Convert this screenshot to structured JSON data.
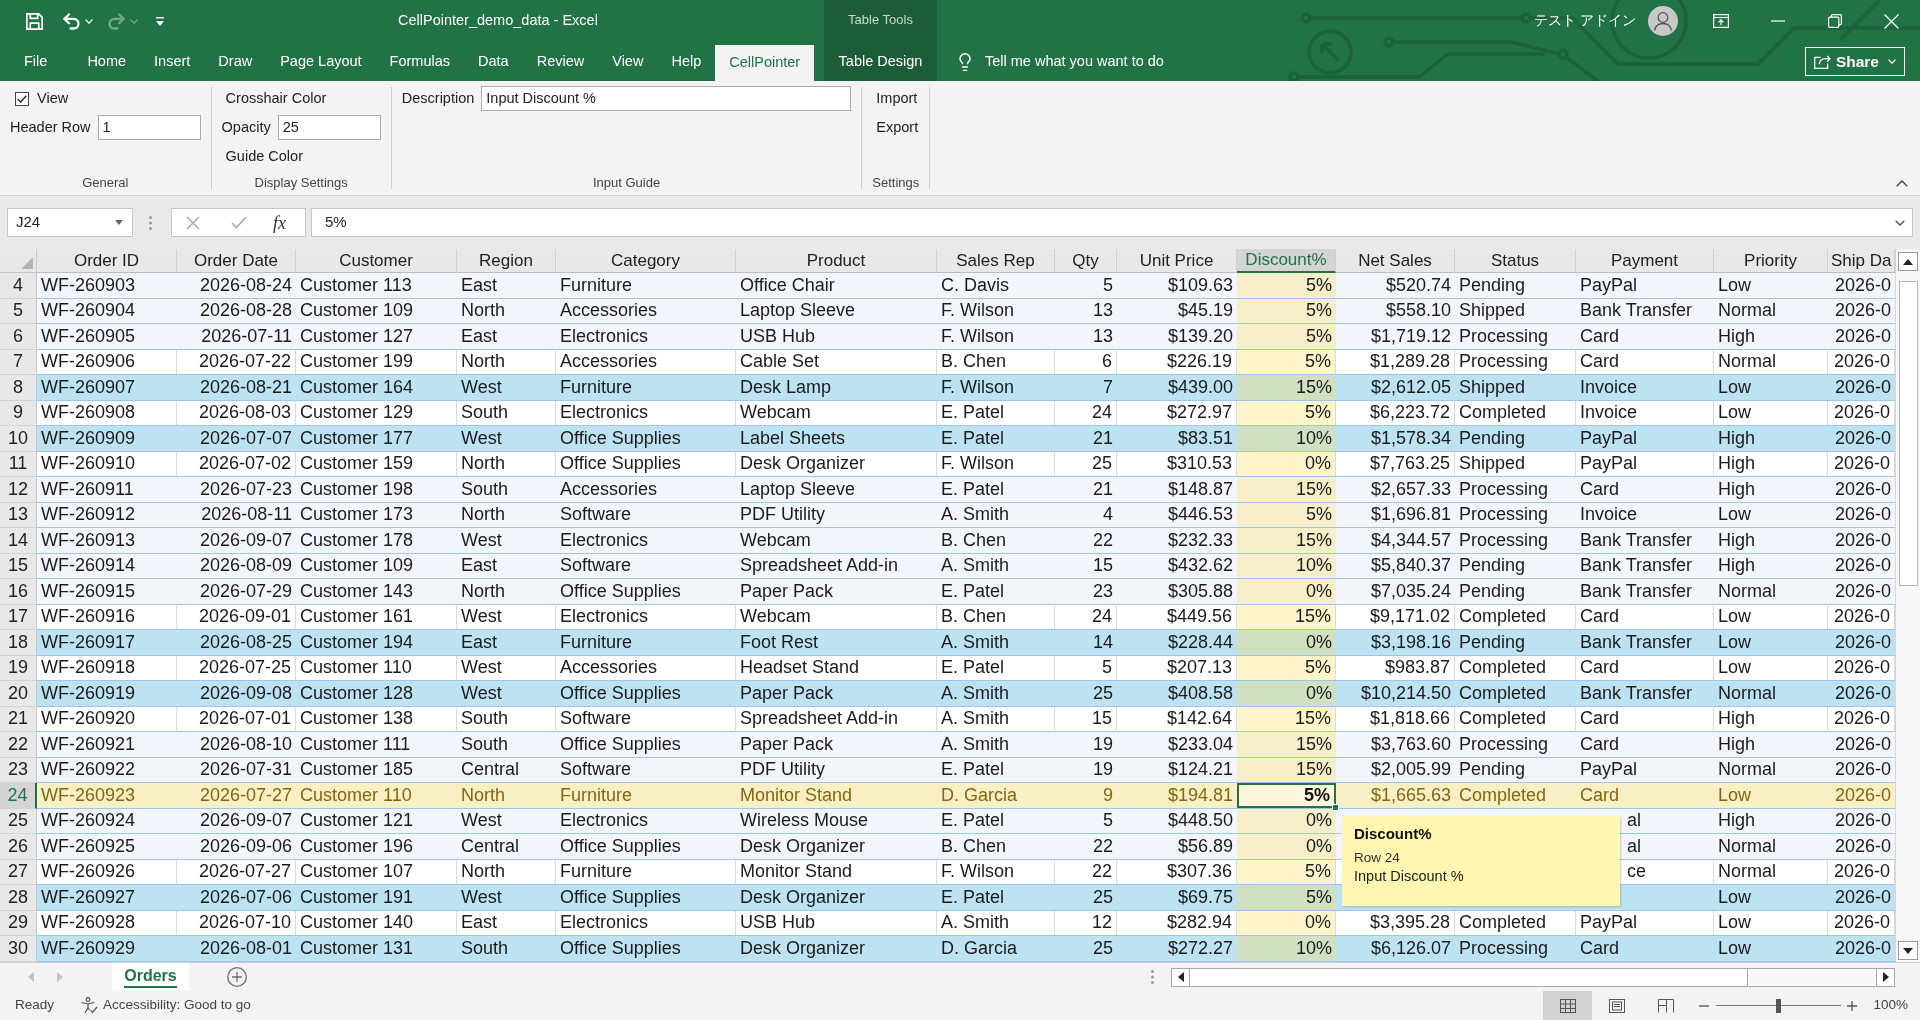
{
  "title_bar": {
    "quick_access": [
      {
        "kind": "save",
        "disabled": false
      },
      {
        "kind": "undo",
        "disabled": false
      },
      {
        "kind": "redo",
        "disabled": true
      },
      {
        "kind": "customize",
        "disabled": false
      }
    ],
    "document_title": "CellPointer_demo_data - Excel",
    "context_label": "Table Tools",
    "user_name": "テスト アドイン"
  },
  "ribbon_tabs": [
    {
      "label": "File",
      "kind": "file",
      "selected": false
    },
    {
      "label": "Home",
      "kind": "standard",
      "selected": false
    },
    {
      "label": "Insert",
      "kind": "standard",
      "selected": false
    },
    {
      "label": "Draw",
      "kind": "standard",
      "selected": false
    },
    {
      "label": "Page Layout",
      "kind": "standard",
      "selected": false
    },
    {
      "label": "Formulas",
      "kind": "standard",
      "selected": false
    },
    {
      "label": "Data",
      "kind": "standard",
      "selected": false
    },
    {
      "label": "Review",
      "kind": "standard",
      "selected": false
    },
    {
      "label": "View",
      "kind": "standard",
      "selected": false
    },
    {
      "label": "Help",
      "kind": "standard",
      "selected": false
    },
    {
      "label": "CellPointer",
      "kind": "standard",
      "selected": true
    },
    {
      "label": "Table Design",
      "kind": "contextual",
      "selected": false
    }
  ],
  "tell_me": {
    "placeholder": "Tell me what you want to do"
  },
  "share_button": {
    "label": "Share"
  },
  "ribbon": {
    "groups": [
      {
        "label": "General",
        "controls": [
          {
            "kind": "checkbox",
            "label": "View",
            "checked": true
          },
          {
            "kind": "field",
            "label": "Header Row",
            "value": "1"
          }
        ]
      },
      {
        "label": "Display Settings",
        "controls": [
          {
            "kind": "button",
            "label": "Crosshair Color"
          },
          {
            "kind": "field",
            "label": "Opacity",
            "value": "25"
          },
          {
            "kind": "button",
            "label": "Guide Color"
          }
        ]
      },
      {
        "label": "Input Guide",
        "controls": [
          {
            "kind": "wide_field",
            "label": "Description",
            "value": "Input Discount %"
          }
        ]
      },
      {
        "label": "Settings",
        "controls": [
          {
            "kind": "button",
            "label": "Import"
          },
          {
            "kind": "button",
            "label": "Export"
          }
        ]
      }
    ]
  },
  "formula_bar": {
    "name_box": "J24",
    "function_label": "fx",
    "formula": "5%"
  },
  "sheet": {
    "columns": [
      {
        "label": "Order ID",
        "kind": "text",
        "selected": false
      },
      {
        "label": "Order Date",
        "kind": "date",
        "selected": false
      },
      {
        "label": "Customer",
        "kind": "text",
        "selected": false
      },
      {
        "label": "Region",
        "kind": "text",
        "selected": false
      },
      {
        "label": "Category",
        "kind": "text",
        "selected": false
      },
      {
        "label": "Product",
        "kind": "text",
        "selected": false
      },
      {
        "label": "Sales Rep",
        "kind": "text",
        "selected": false
      },
      {
        "label": "Qty",
        "kind": "number",
        "selected": false
      },
      {
        "label": "Unit Price",
        "kind": "currency",
        "selected": false
      },
      {
        "label": "Discount%",
        "kind": "percent",
        "selected": true
      },
      {
        "label": "Net Sales",
        "kind": "currency",
        "selected": false
      },
      {
        "label": "Status",
        "kind": "text",
        "selected": false
      },
      {
        "label": "Payment",
        "kind": "text",
        "selected": false
      },
      {
        "label": "Priority",
        "kind": "text",
        "selected": false
      },
      {
        "label": "Ship Da",
        "kind": "date",
        "selected": false
      }
    ],
    "rows": [
      {
        "number": "4",
        "color": "#f2f6fc",
        "selected": false,
        "order_id": "WF-260903",
        "order_date": "2026-08-24",
        "customer": "Customer 113",
        "region": "East",
        "category": "Furniture",
        "product": "Office Chair",
        "sales_rep": "C. Davis",
        "qty": "5",
        "unit_price": "$109.63",
        "discount": "5%",
        "net_sales": "$520.74",
        "status": "Pending",
        "payment": "PayPal",
        "priority": "Low",
        "column_15": "2026-0"
      },
      {
        "number": "5",
        "color": "#f2f6fc",
        "selected": false,
        "order_id": "WF-260904",
        "order_date": "2026-08-28",
        "customer": "Customer 109",
        "region": "North",
        "category": "Accessories",
        "product": "Laptop Sleeve",
        "sales_rep": "F. Wilson",
        "qty": "13",
        "unit_price": "$45.19",
        "discount": "5%",
        "net_sales": "$558.10",
        "status": "Shipped",
        "payment": "Bank Transfer",
        "priority": "Normal",
        "column_15": "2026-0"
      },
      {
        "number": "6",
        "color": "#f2f6fc",
        "selected": false,
        "order_id": "WF-260905",
        "order_date": "2026-07-11",
        "customer": "Customer 127",
        "region": "East",
        "category": "Electronics",
        "product": "USB Hub",
        "sales_rep": "F. Wilson",
        "qty": "13",
        "unit_price": "$139.20",
        "discount": "5%",
        "net_sales": "$1,719.12",
        "status": "Processing",
        "payment": "Card",
        "priority": "High",
        "column_15": "2026-0"
      },
      {
        "number": "7",
        "selected": false,
        "order_id": "WF-260906",
        "order_date": "2026-07-22",
        "customer": "Customer 199",
        "region": "North",
        "category": "Accessories",
        "product": "Cable Set",
        "sales_rep": "B. Chen",
        "qty": "6",
        "unit_price": "$226.19",
        "discount": "5%",
        "net_sales": "$1,289.28",
        "status": "Processing",
        "payment": "Card",
        "priority": "Normal",
        "column_15": "2026-0"
      },
      {
        "number": "8",
        "color": "#bde3f3",
        "selected": false,
        "order_id": "WF-260907",
        "order_date": "2026-08-21",
        "customer": "Customer 164",
        "region": "West",
        "category": "Furniture",
        "product": "Desk Lamp",
        "sales_rep": "F. Wilson",
        "qty": "7",
        "unit_price": "$439.00",
        "discount": "15%",
        "net_sales": "$2,612.05",
        "status": "Shipped",
        "payment": "Invoice",
        "priority": "Low",
        "column_15": "2026-0"
      },
      {
        "number": "9",
        "selected": false,
        "order_id": "WF-260908",
        "order_date": "2026-08-03",
        "customer": "Customer 129",
        "region": "South",
        "category": "Electronics",
        "product": "Webcam",
        "sales_rep": "E. Patel",
        "qty": "24",
        "unit_price": "$272.97",
        "discount": "5%",
        "net_sales": "$6,223.72",
        "status": "Completed",
        "payment": "Invoice",
        "priority": "Low",
        "column_15": "2026-0"
      },
      {
        "number": "10",
        "color": "#bde3f3",
        "selected": false,
        "order_id": "WF-260909",
        "order_date": "2026-07-07",
        "customer": "Customer 177",
        "region": "West",
        "category": "Office Supplies",
        "product": "Label Sheets",
        "sales_rep": "E. Patel",
        "qty": "21",
        "unit_price": "$83.51",
        "discount": "10%",
        "net_sales": "$1,578.34",
        "status": "Pending",
        "payment": "PayPal",
        "priority": "High",
        "column_15": "2026-0"
      },
      {
        "number": "11",
        "selected": false,
        "order_id": "WF-260910",
        "order_date": "2026-07-02",
        "customer": "Customer 159",
        "region": "North",
        "category": "Office Supplies",
        "product": "Desk Organizer",
        "sales_rep": "F. Wilson",
        "qty": "25",
        "unit_price": "$310.53",
        "discount": "0%",
        "net_sales": "$7,763.25",
        "status": "Shipped",
        "payment": "PayPal",
        "priority": "High",
        "column_15": "2026-0"
      },
      {
        "number": "12",
        "color": "#f2f6fc",
        "selected": false,
        "order_id": "WF-260911",
        "order_date": "2026-07-23",
        "customer": "Customer 198",
        "region": "South",
        "category": "Accessories",
        "product": "Laptop Sleeve",
        "sales_rep": "E. Patel",
        "qty": "21",
        "unit_price": "$148.87",
        "discount": "15%",
        "net_sales": "$2,657.33",
        "status": "Processing",
        "payment": "Card",
        "priority": "High",
        "column_15": "2026-0"
      },
      {
        "number": "13",
        "color": "#f2f6fc",
        "selected": false,
        "order_id": "WF-260912",
        "order_date": "2026-08-11",
        "customer": "Customer 173",
        "region": "North",
        "category": "Software",
        "product": "PDF Utility",
        "sales_rep": "A. Smith",
        "qty": "4",
        "unit_price": "$446.53",
        "discount": "5%",
        "net_sales": "$1,696.81",
        "status": "Processing",
        "payment": "Invoice",
        "priority": "Low",
        "column_15": "2026-0"
      },
      {
        "number": "14",
        "color": "#f2f6fc",
        "selected": false,
        "order_id": "WF-260913",
        "order_date": "2026-09-07",
        "customer": "Customer 178",
        "region": "West",
        "category": "Electronics",
        "product": "Webcam",
        "sales_rep": "B. Chen",
        "qty": "22",
        "unit_price": "$232.33",
        "discount": "15%",
        "net_sales": "$4,344.57",
        "status": "Processing",
        "payment": "Bank Transfer",
        "priority": "High",
        "column_15": "2026-0"
      },
      {
        "number": "15",
        "color": "#f2f6fc",
        "selected": false,
        "order_id": "WF-260914",
        "order_date": "2026-08-09",
        "customer": "Customer 109",
        "region": "East",
        "category": "Software",
        "product": "Spreadsheet Add-in",
        "sales_rep": "A. Smith",
        "qty": "15",
        "unit_price": "$432.62",
        "discount": "10%",
        "net_sales": "$5,840.37",
        "status": "Pending",
        "payment": "Bank Transfer",
        "priority": "High",
        "column_15": "2026-0"
      },
      {
        "number": "16",
        "color": "#f2f6fc",
        "selected": false,
        "order_id": "WF-260915",
        "order_date": "2026-07-29",
        "customer": "Customer 143",
        "region": "North",
        "category": "Office Supplies",
        "product": "Paper Pack",
        "sales_rep": "E. Patel",
        "qty": "23",
        "unit_price": "$305.88",
        "discount": "0%",
        "net_sales": "$7,035.24",
        "status": "Pending",
        "payment": "Bank Transfer",
        "priority": "Normal",
        "column_15": "2026-0"
      },
      {
        "number": "17",
        "selected": false,
        "order_id": "WF-260916",
        "order_date": "2026-09-01",
        "customer": "Customer 161",
        "region": "West",
        "category": "Electronics",
        "product": "Webcam",
        "sales_rep": "B. Chen",
        "qty": "24",
        "unit_price": "$449.56",
        "discount": "15%",
        "net_sales": "$9,171.02",
        "status": "Completed",
        "payment": "Card",
        "priority": "Low",
        "column_15": "2026-0"
      },
      {
        "number": "18",
        "color": "#bde3f3",
        "selected": false,
        "order_id": "WF-260917",
        "order_date": "2026-08-25",
        "customer": "Customer 194",
        "region": "East",
        "category": "Furniture",
        "product": "Foot Rest",
        "sales_rep": "A. Smith",
        "qty": "14",
        "unit_price": "$228.44",
        "discount": "0%",
        "net_sales": "$3,198.16",
        "status": "Pending",
        "payment": "Bank Transfer",
        "priority": "Low",
        "column_15": "2026-0"
      },
      {
        "number": "19",
        "selected": false,
        "order_id": "WF-260918",
        "order_date": "2026-07-25",
        "customer": "Customer 110",
        "region": "West",
        "category": "Accessories",
        "product": "Headset Stand",
        "sales_rep": "E. Patel",
        "qty": "5",
        "unit_price": "$207.13",
        "discount": "5%",
        "net_sales": "$983.87",
        "status": "Completed",
        "payment": "Card",
        "priority": "Low",
        "column_15": "2026-0"
      },
      {
        "number": "20",
        "color": "#bde3f3",
        "selected": false,
        "order_id": "WF-260919",
        "order_date": "2026-09-08",
        "customer": "Customer 128",
        "region": "West",
        "category": "Office Supplies",
        "product": "Paper Pack",
        "sales_rep": "A. Smith",
        "qty": "25",
        "unit_price": "$408.58",
        "discount": "0%",
        "net_sales": "$10,214.50",
        "status": "Completed",
        "payment": "Bank Transfer",
        "priority": "Normal",
        "column_15": "2026-0"
      },
      {
        "number": "21",
        "selected": false,
        "order_id": "WF-260920",
        "order_date": "2026-07-01",
        "customer": "Customer 138",
        "region": "South",
        "category": "Software",
        "product": "Spreadsheet Add-in",
        "sales_rep": "A. Smith",
        "qty": "15",
        "unit_price": "$142.64",
        "discount": "15%",
        "net_sales": "$1,818.66",
        "status": "Completed",
        "payment": "Card",
        "priority": "High",
        "column_15": "2026-0"
      },
      {
        "number": "22",
        "color": "#f2f6fc",
        "selected": false,
        "order_id": "WF-260921",
        "order_date": "2026-08-10",
        "customer": "Customer 111",
        "region": "South",
        "category": "Office Supplies",
        "product": "Paper Pack",
        "sales_rep": "A. Smith",
        "qty": "19",
        "unit_price": "$233.04",
        "discount": "15%",
        "net_sales": "$3,763.60",
        "status": "Processing",
        "payment": "Card",
        "priority": "High",
        "column_15": "2026-0"
      },
      {
        "number": "23",
        "color": "#f2f6fc",
        "selected": false,
        "order_id": "WF-260922",
        "order_date": "2026-07-31",
        "customer": "Customer 185",
        "region": "Central",
        "category": "Software",
        "product": "PDF Utility",
        "sales_rep": "E. Patel",
        "qty": "19",
        "unit_price": "$124.21",
        "discount": "15%",
        "net_sales": "$2,005.99",
        "status": "Pending",
        "payment": "PayPal",
        "priority": "Normal",
        "column_15": "2026-0"
      },
      {
        "number": "24",
        "color": "#f8efc5",
        "selected": true,
        "order_id": "WF-260923",
        "order_date": "2026-07-27",
        "customer": "Customer 110",
        "region": "North",
        "category": "Furniture",
        "product": "Monitor Stand",
        "sales_rep": "D. Garcia",
        "qty": "9",
        "unit_price": "$194.81",
        "discount": "5%",
        "net_sales": "$1,665.63",
        "status": "Completed",
        "payment": "Card",
        "priority": "Low",
        "column_15": "2026-0"
      },
      {
        "number": "25",
        "color": "#f2f6fc",
        "selected": false,
        "under_tooltip": true,
        "order_id": "WF-260924",
        "order_date": "2026-09-07",
        "customer": "Customer 121",
        "region": "West",
        "category": "Electronics",
        "product": "Wireless Mouse",
        "sales_rep": "E. Patel",
        "qty": "5",
        "unit_price": "$448.50",
        "discount": "0%",
        "payment": "al",
        "priority": "High",
        "column_15": "2026-0"
      },
      {
        "number": "26",
        "color": "#f2f6fc",
        "selected": false,
        "under_tooltip": true,
        "order_id": "WF-260925",
        "order_date": "2026-09-06",
        "customer": "Customer 196",
        "region": "Central",
        "category": "Office Supplies",
        "product": "Desk Organizer",
        "sales_rep": "B. Chen",
        "qty": "22",
        "unit_price": "$56.89",
        "discount": "0%",
        "payment": "al",
        "priority": "Normal",
        "column_15": "2026-0"
      },
      {
        "number": "27",
        "selected": false,
        "under_tooltip": true,
        "order_id": "WF-260926",
        "order_date": "2026-07-27",
        "customer": "Customer 107",
        "region": "North",
        "category": "Furniture",
        "product": "Monitor Stand",
        "sales_rep": "F. Wilson",
        "qty": "22",
        "unit_price": "$307.36",
        "discount": "5%",
        "payment": "ce",
        "priority": "Normal",
        "column_15": "2026-0"
      },
      {
        "number": "28",
        "color": "#bde3f3",
        "selected": false,
        "order_id": "WF-260927",
        "order_date": "2026-07-06",
        "customer": "Customer 191",
        "region": "West",
        "category": "Office Supplies",
        "product": "Desk Organizer",
        "sales_rep": "E. Patel",
        "qty": "25",
        "unit_price": "$69.75",
        "discount": "5%",
        "priority": "Low",
        "column_15": "2026-0"
      },
      {
        "number": "29",
        "selected": false,
        "order_id": "WF-260928",
        "order_date": "2026-07-10",
        "customer": "Customer 140",
        "region": "East",
        "category": "Electronics",
        "product": "USB Hub",
        "sales_rep": "A. Smith",
        "qty": "12",
        "unit_price": "$282.94",
        "discount": "0%",
        "net_sales": "$3,395.28",
        "status": "Completed",
        "payment": "PayPal",
        "priority": "Low",
        "column_15": "2026-0"
      },
      {
        "number": "30",
        "color": "#bde3f3",
        "selected": false,
        "order_id": "WF-260929",
        "order_date": "2026-08-01",
        "customer": "Customer 131",
        "region": "South",
        "category": "Office Supplies",
        "product": "Desk Organizer",
        "sales_rep": "D. Garcia",
        "qty": "25",
        "unit_price": "$272.27",
        "discount": "10%",
        "net_sales": "$6,126.07",
        "status": "Processing",
        "payment": "Card",
        "priority": "Low",
        "column_15": "2026-0"
      }
    ]
  },
  "tooltip": {
    "title": "Discount%",
    "row": "Row 24",
    "description": "Input Discount %"
  },
  "sheet_tabs": [
    {
      "label": "Orders",
      "selected": true
    }
  ],
  "status_bar": {
    "mode": "Ready",
    "accessibility": "Accessibility: Good to go",
    "views": [
      {
        "kind": "normal",
        "selected": true
      },
      {
        "kind": "page_layout",
        "selected": false
      },
      {
        "kind": "page_break_preview",
        "selected": false
      }
    ],
    "zoom": {
      "level": 0.5,
      "reading": "100%"
    }
  }
}
